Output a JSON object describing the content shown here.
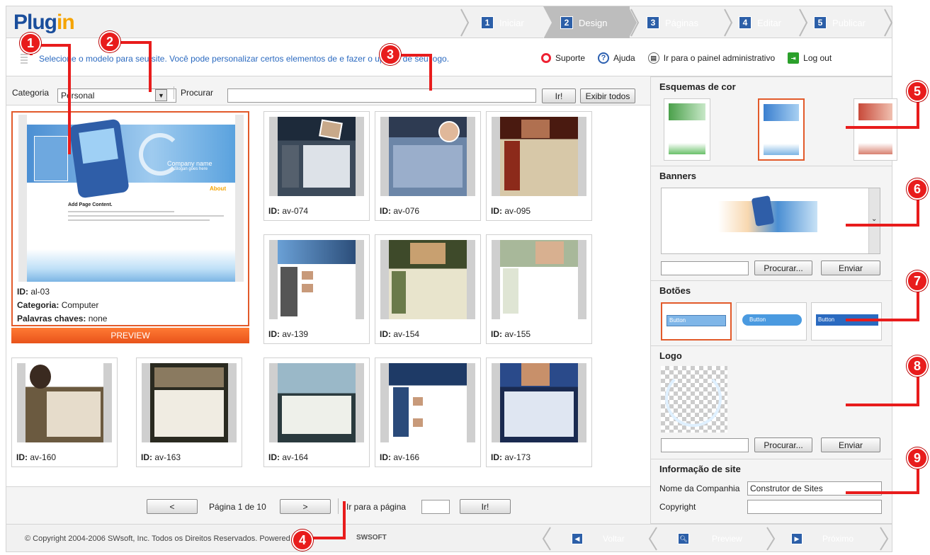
{
  "header": {
    "logo_main": "Plug",
    "logo_accent": "in",
    "steps": [
      {
        "num": "1",
        "label": "Iniciar"
      },
      {
        "num": "2",
        "label": "Design"
      },
      {
        "num": "3",
        "label": "Páginas"
      },
      {
        "num": "4",
        "label": "Editar"
      },
      {
        "num": "5",
        "label": "Publicar"
      }
    ]
  },
  "infobar": {
    "message": "Selecione o modelo para seu site. Você pode personalizar certos elementos de e fazer o upload de seu logo.",
    "links": [
      "Suporte",
      "Ajuda",
      "Ir para o painel administrativo",
      "Log out"
    ]
  },
  "filters": {
    "category_label": "Categoria",
    "category_value": "Personal",
    "search_label": "Procurar",
    "search_value": "",
    "go_label": "Ir!",
    "show_all_label": "Exibir todos"
  },
  "featured": {
    "id_label": "ID:",
    "id_value": "al-03",
    "category_label": "Categoria:",
    "category_value": "Computer",
    "keywords_label": "Palavras chaves:",
    "keywords_value": "none",
    "preview_label": "PREVIEW",
    "thumb_company": "Company name",
    "thumb_slogan": "Slogan goes here",
    "thumb_about": "About",
    "thumb_heading": "Add Page Content."
  },
  "templates": [
    {
      "id": "av-074"
    },
    {
      "id": "av-076"
    },
    {
      "id": "av-095"
    },
    {
      "id": "av-139"
    },
    {
      "id": "av-154"
    },
    {
      "id": "av-155"
    },
    {
      "id": "av-160"
    },
    {
      "id": "av-163"
    },
    {
      "id": "av-164"
    },
    {
      "id": "av-166"
    },
    {
      "id": "av-173"
    }
  ],
  "id_label": "ID:",
  "pagination": {
    "prev": "<",
    "page_text": "Página 1 de 10",
    "next": ">",
    "goto_label": "Ir para a página",
    "go_label": "Ir!"
  },
  "right": {
    "schemes_title": "Esquemas de cor",
    "banners_title": "Banners",
    "browse_label": "Procurar...",
    "send_label": "Enviar",
    "buttons_title": "Botões",
    "button_sample": "Button",
    "logo_title": "Logo",
    "site_info_title": "Informação de site",
    "company_label": "Nome da Companhia",
    "company_value": "Construtor de Sites",
    "copyright_label": "Copyright",
    "copyright_value": ""
  },
  "footer": {
    "copyright": "© Copyright 2004-2006 SWsoft, Inc. Todos os Direitos Reservados. Powered by",
    "brand": "SWSOFT",
    "back": "Voltar",
    "preview": "Preview",
    "next": "Próximo"
  },
  "markers": [
    "1",
    "2",
    "3",
    "4",
    "5",
    "6",
    "7",
    "8",
    "9"
  ],
  "colors": {
    "accent": "#e25a2a",
    "marker": "#e81c1c",
    "step_blue": "#2c5fa8",
    "link_blue": "#2b6ac0"
  }
}
